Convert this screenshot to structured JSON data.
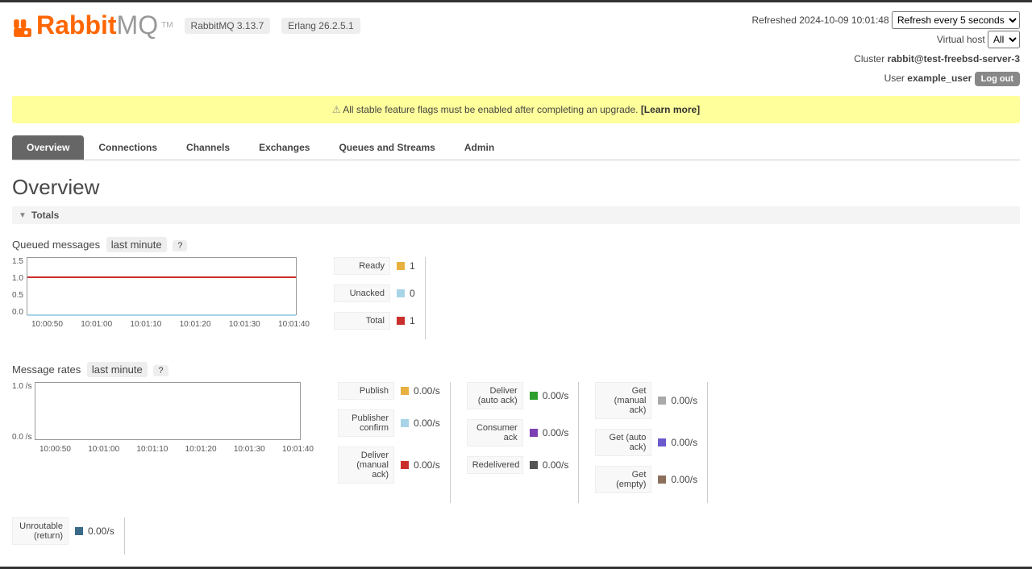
{
  "header": {
    "refreshed_label": "Refreshed",
    "refreshed_time": "2024-10-09 10:01:48",
    "refresh_select": "Refresh every 5 seconds",
    "vhost_label": "Virtual host",
    "vhost_select": "All",
    "cluster_label": "Cluster",
    "cluster_name": "rabbit@test-freebsd-server-3",
    "user_label": "User",
    "user_name": "example_user",
    "logout": "Log out",
    "version1": "RabbitMQ 3.13.7",
    "version2": "Erlang 26.2.5.1",
    "logo_rabbit": "Rabbit",
    "logo_mq": "MQ",
    "logo_tm": "TM"
  },
  "banner": {
    "text": "All stable feature flags must be enabled after completing an upgrade. ",
    "link": "[Learn more]"
  },
  "tabs": [
    "Overview",
    "Connections",
    "Channels",
    "Exchanges",
    "Queues and Streams",
    "Admin"
  ],
  "page_title": "Overview",
  "section_totals": "Totals",
  "queued": {
    "title": "Queued messages",
    "range": "last minute",
    "help": "?",
    "legend": [
      {
        "label": "Ready",
        "color": "#e8b03f",
        "value": "1"
      },
      {
        "label": "Unacked",
        "color": "#a8d4e8",
        "value": "0"
      },
      {
        "label": "Total",
        "color": "#c9302c",
        "value": "1"
      }
    ]
  },
  "rates": {
    "title": "Message rates",
    "range": "last minute",
    "help": "?",
    "cols": [
      [
        {
          "label": "Publish",
          "color": "#e8b03f",
          "value": "0.00/s"
        },
        {
          "label": "Publisher confirm",
          "color": "#a8d4e8",
          "value": "0.00/s"
        },
        {
          "label": "Deliver (manual ack)",
          "color": "#c9302c",
          "value": "0.00/s"
        }
      ],
      [
        {
          "label": "Deliver (auto ack)",
          "color": "#2e9e2e",
          "value": "0.00/s"
        },
        {
          "label": "Consumer ack",
          "color": "#7b3fb3",
          "value": "0.00/s"
        },
        {
          "label": "Redelivered",
          "color": "#555555",
          "value": "0.00/s"
        }
      ],
      [
        {
          "label": "Get (manual ack)",
          "color": "#aaaaaa",
          "value": "0.00/s"
        },
        {
          "label": "Get (auto ack)",
          "color": "#6a5acd",
          "value": "0.00/s"
        },
        {
          "label": "Get (empty)",
          "color": "#8b6f5c",
          "value": "0.00/s"
        }
      ]
    ],
    "extra": [
      {
        "label": "Unroutable (return)",
        "color": "#3a6a8a",
        "value": "0.00/s"
      }
    ]
  },
  "chart_data": [
    {
      "type": "line",
      "title": "Queued messages",
      "x_ticks": [
        "10:00:50",
        "10:01:00",
        "10:01:10",
        "10:01:20",
        "10:01:30",
        "10:01:40"
      ],
      "y_ticks": [
        "0.0",
        "0.5",
        "1.0",
        "1.5"
      ],
      "ylim": [
        0,
        1.5
      ],
      "series": [
        {
          "name": "Ready",
          "color": "#e8b03f",
          "values": [
            1,
            1,
            1,
            1,
            1,
            1
          ]
        },
        {
          "name": "Unacked",
          "color": "#a8d4e8",
          "values": [
            0,
            0,
            0,
            0,
            0,
            0
          ]
        },
        {
          "name": "Total",
          "color": "#c9302c",
          "values": [
            1,
            1,
            1,
            1,
            1,
            1
          ]
        }
      ]
    },
    {
      "type": "line",
      "title": "Message rates",
      "x_ticks": [
        "10:00:50",
        "10:01:00",
        "10:01:10",
        "10:01:20",
        "10:01:30",
        "10:01:40"
      ],
      "y_ticks": [
        "0.0 /s",
        "1.0 /s"
      ],
      "ylim": [
        0,
        1.0
      ],
      "series": [
        {
          "name": "Publish",
          "values": [
            0,
            0,
            0,
            0,
            0,
            0
          ]
        },
        {
          "name": "Publisher confirm",
          "values": [
            0,
            0,
            0,
            0,
            0,
            0
          ]
        },
        {
          "name": "Deliver (manual ack)",
          "values": [
            0,
            0,
            0,
            0,
            0,
            0
          ]
        },
        {
          "name": "Deliver (auto ack)",
          "values": [
            0,
            0,
            0,
            0,
            0,
            0
          ]
        },
        {
          "name": "Consumer ack",
          "values": [
            0,
            0,
            0,
            0,
            0,
            0
          ]
        },
        {
          "name": "Redelivered",
          "values": [
            0,
            0,
            0,
            0,
            0,
            0
          ]
        },
        {
          "name": "Get (manual ack)",
          "values": [
            0,
            0,
            0,
            0,
            0,
            0
          ]
        },
        {
          "name": "Get (auto ack)",
          "values": [
            0,
            0,
            0,
            0,
            0,
            0
          ]
        },
        {
          "name": "Get (empty)",
          "values": [
            0,
            0,
            0,
            0,
            0,
            0
          ]
        }
      ]
    }
  ]
}
